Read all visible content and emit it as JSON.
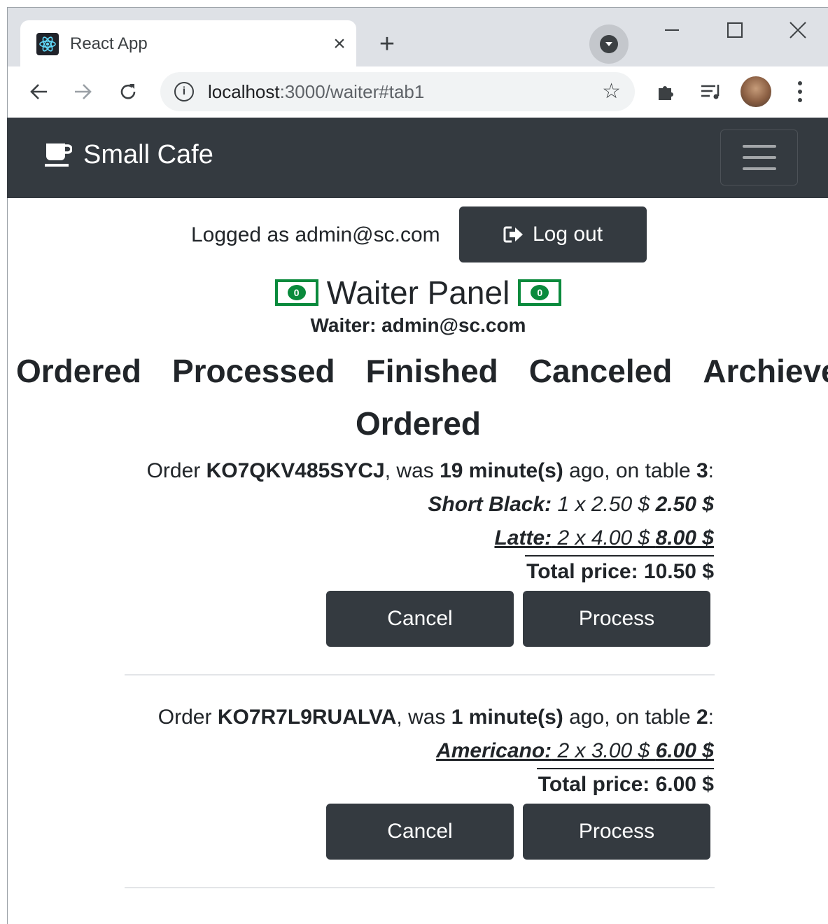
{
  "browser": {
    "tab_title": "React App",
    "url_host": "localhost",
    "url_rest": ":3000/waiter#tab1"
  },
  "navbar": {
    "brand": "Small Cafe"
  },
  "session": {
    "logged_text": "Logged as admin@sc.com",
    "logout_label": "Log out"
  },
  "panel": {
    "title": "Waiter Panel",
    "waiter_line": "Waiter: admin@sc.com"
  },
  "tabs": [
    "Ordered",
    "Processed",
    "Finished",
    "Canceled",
    "Archieved"
  ],
  "section_title": "Ordered",
  "orders": [
    {
      "prefix": "Order ",
      "id": "KO7QKV485SYCJ",
      "was": ", was ",
      "time": "19 minute(s)",
      "table_text": " ago, on table ",
      "table": "3",
      "suffix": ":",
      "items": [
        {
          "name": "Short Black:",
          "qty_price": " 1 x 2.50 $ ",
          "subtotal": "2.50 $"
        },
        {
          "name": "Latte:",
          "qty_price": " 2 x 4.00 $ ",
          "subtotal": "8.00 $"
        }
      ],
      "total": "Total price: 10.50 $",
      "cancel_label": "Cancel",
      "process_label": "Process"
    },
    {
      "prefix": "Order ",
      "id": "KO7R7L9RUALVA",
      "was": ", was ",
      "time": "1 minute(s)",
      "table_text": " ago, on table ",
      "table": "2",
      "suffix": ":",
      "items": [
        {
          "name": "Americano:",
          "qty_price": " 2 x 3.00 $ ",
          "subtotal": "6.00 $"
        }
      ],
      "total": "Total price: 6.00 $",
      "cancel_label": "Cancel",
      "process_label": "Process"
    }
  ],
  "colors": {
    "navbar_bg": "#343a40",
    "button_bg": "#343a40",
    "money_green": "#0a8a3c"
  }
}
